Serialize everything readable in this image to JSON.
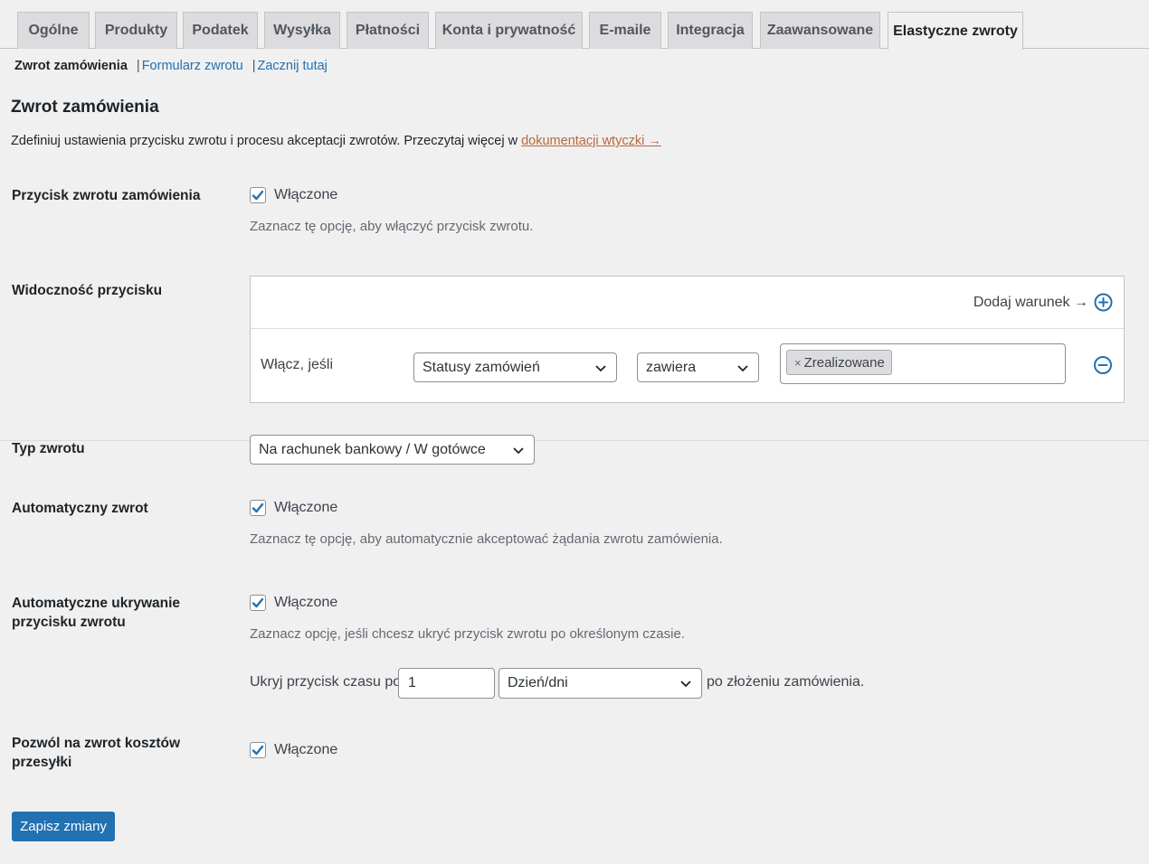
{
  "tabs": [
    {
      "label": "Ogólne"
    },
    {
      "label": "Produkty"
    },
    {
      "label": "Podatek"
    },
    {
      "label": "Wysyłka"
    },
    {
      "label": "Płatności"
    },
    {
      "label": "Konta i prywatność"
    },
    {
      "label": "E-maile"
    },
    {
      "label": "Integracja"
    },
    {
      "label": "Zaawansowane"
    },
    {
      "label": "Elastyczne zwroty",
      "active": true
    }
  ],
  "subnav": {
    "current": "Zwrot zamówienia",
    "links": [
      "Formularz zwrotu",
      "Zacznij tutaj"
    ],
    "separator": "|"
  },
  "section": {
    "title": "Zwrot zamówienia",
    "description": "Zdefiniuj ustawienia przycisku zwrotu i procesu akceptacji zwrotów. Przeczytaj więcej w ",
    "doc_link": "dokumentacji wtyczki →"
  },
  "refund_button": {
    "label": "Przycisk zwrotu zamówienia",
    "checkbox_label": "Włączone",
    "checked": true,
    "help": "Zaznacz tę opcję, aby włączyć przycisk zwrotu."
  },
  "visibility": {
    "label": "Widoczność przycisku",
    "add_condition": "Dodaj warunek →",
    "enable_if": "Włącz, jeśli",
    "field_select": "Statusy zamówień",
    "operator_select": "zawiera",
    "tags": [
      "Zrealizowane"
    ],
    "tag_remove": "×"
  },
  "refund_type": {
    "label": "Typ zwrotu",
    "value": "Na rachunek bankowy / W gotówce"
  },
  "auto_refund": {
    "label": "Automatyczny zwrot",
    "checkbox_label": "Włączone",
    "checked": true,
    "help": "Zaznacz tę opcję, aby automatycznie akceptować żądania zwrotu zamówienia."
  },
  "auto_hide": {
    "label": "Automatyczne ukrywanie przycisku zwrotu",
    "checkbox_label": "Włączone",
    "checked": true,
    "help": "Zaznacz opcję, jeśli chcesz ukryć przycisk zwrotu po określonym czasie.",
    "prefix": "Ukryj przycisk czasu po",
    "amount": "1",
    "unit": "Dzień/dni",
    "suffix": "po złożeniu zamówienia."
  },
  "shipping_refund": {
    "label": "Pozwól na zwrot kosztów przesyłki",
    "checkbox_label": "Włączone",
    "checked": true
  },
  "save_button": "Zapisz zmiany",
  "colors": {
    "primary": "#2271b1",
    "link_accent": "#b8683c",
    "background": "#f0f0f1"
  }
}
